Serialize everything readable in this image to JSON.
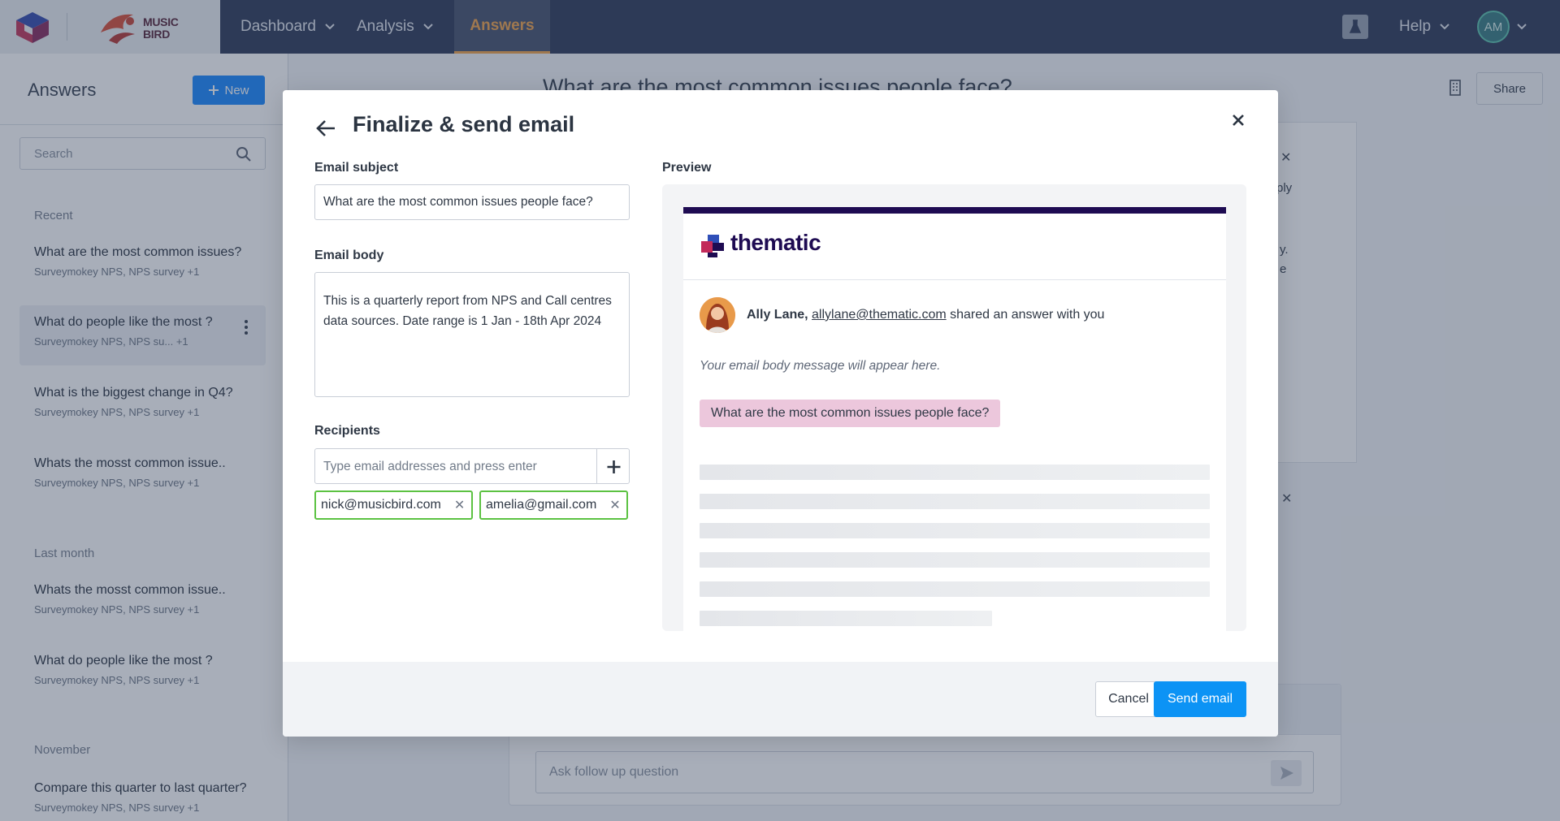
{
  "topnav": {
    "brand_name": "MUSIC BIRD",
    "brand_line1": "MUSIC",
    "brand_line2": "BIRD",
    "items": [
      {
        "label": "Dashboard"
      },
      {
        "label": "Analysis"
      }
    ],
    "active": "Answers",
    "help": "Help",
    "avatar_initials": "AM"
  },
  "sidebar": {
    "title": "Answers",
    "new_label": "New",
    "search_placeholder": "Search",
    "sections": [
      {
        "name": "Recent",
        "items": [
          {
            "question": "What are the most common issues?",
            "source": "Surveymokey NPS, NPS survey   +1"
          },
          {
            "question": "What do people like the most ?",
            "source": "Surveymokey NPS, NPS su...   +1"
          },
          {
            "question": "What is the biggest change in Q4?",
            "source": "Surveymokey NPS, NPS survey   +1"
          },
          {
            "question": "Whats the mosst common issue..",
            "source": "Surveymokey NPS, NPS survey   +1"
          }
        ]
      },
      {
        "name": "Last month",
        "items": [
          {
            "question": "Whats the mosst common issue..",
            "source": "Surveymokey NPS, NPS survey   +1"
          },
          {
            "question": "What do people like the most ?",
            "source": "Surveymokey NPS, NPS survey   +1"
          }
        ]
      },
      {
        "name": "November",
        "items": [
          {
            "question": "Compare this quarter to last quarter?",
            "source": "Surveymokey NPS, NPS survey   +1"
          }
        ]
      }
    ]
  },
  "main": {
    "title": "What are the most common issues people face?",
    "share_label": "Share",
    "follow_placeholder": "Ask follow up question",
    "partial_text_1": "ply",
    "partial_text_2": "y.",
    "partial_text_3": "e"
  },
  "modal": {
    "title": "Finalize & send email",
    "subject_label": "Email subject",
    "subject_value": "What are the most common issues people face?",
    "body_label": "Email body",
    "body_value": "This is a quarterly report from NPS and Call centres data sources. Date range is 1 Jan - 18th Apr 2024",
    "recipients_label": "Recipients",
    "recipients_placeholder": "Type email addresses and press enter",
    "recipients": [
      "nick@musicbird.com",
      "amelia@gmail.com"
    ],
    "preview_label": "Preview",
    "preview": {
      "brand": "thematic",
      "sender_name": "Ally Lane,",
      "sender_email": "allylane@thematic.com",
      "shared_text": "shared an answer with you",
      "body_placeholder": "Your email body message will appear here.",
      "question": "What are the most common issues people face?"
    },
    "cancel_label": "Cancel",
    "send_label": "Send email"
  },
  "colors": {
    "nav_bg": "#323f5c",
    "accent_orange": "#f0a54f",
    "primary_blue": "#0c93f5",
    "chip_green": "#5cc242",
    "thematic_navy": "#1e0b52",
    "pill_pink": "#ecc7dc"
  }
}
